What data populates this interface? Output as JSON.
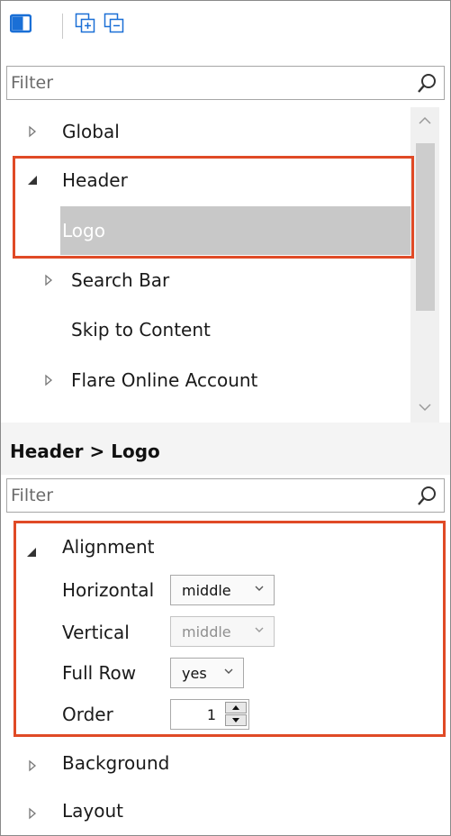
{
  "toolbar": {
    "buttons": [
      {
        "icon": "panel-toggle-icon"
      },
      {
        "icon": "expand-all-icon"
      },
      {
        "icon": "collapse-all-icon"
      }
    ],
    "accent": "#1a6fd6"
  },
  "top_filter": {
    "placeholder": "Filter"
  },
  "tree": {
    "items": [
      {
        "label": "Global",
        "expander": "collapsed"
      },
      {
        "label": "Header",
        "expander": "expanded"
      },
      {
        "label": "Logo",
        "expander": "none",
        "selected": true
      },
      {
        "label": "Search Bar",
        "expander": "collapsed"
      },
      {
        "label": "Skip to Content",
        "expander": "none"
      },
      {
        "label": "Flare Online Account",
        "expander": "collapsed"
      }
    ]
  },
  "properties": {
    "breadcrumb": "Header > Logo",
    "filter_placeholder": "Filter",
    "groups": [
      {
        "label": "Alignment",
        "expander": "expanded"
      },
      {
        "label": "Background",
        "expander": "collapsed"
      },
      {
        "label": "Layout",
        "expander": "collapsed"
      }
    ],
    "alignment": {
      "horizontal": {
        "label": "Horizontal",
        "value": "middle"
      },
      "vertical": {
        "label": "Vertical",
        "value": "middle",
        "disabled": true
      },
      "full_row": {
        "label": "Full Row",
        "value": "yes"
      },
      "order": {
        "label": "Order",
        "value": "1"
      }
    }
  },
  "colors": {
    "highlight": "#e04a26",
    "selected_row": "#c8c8c8"
  }
}
